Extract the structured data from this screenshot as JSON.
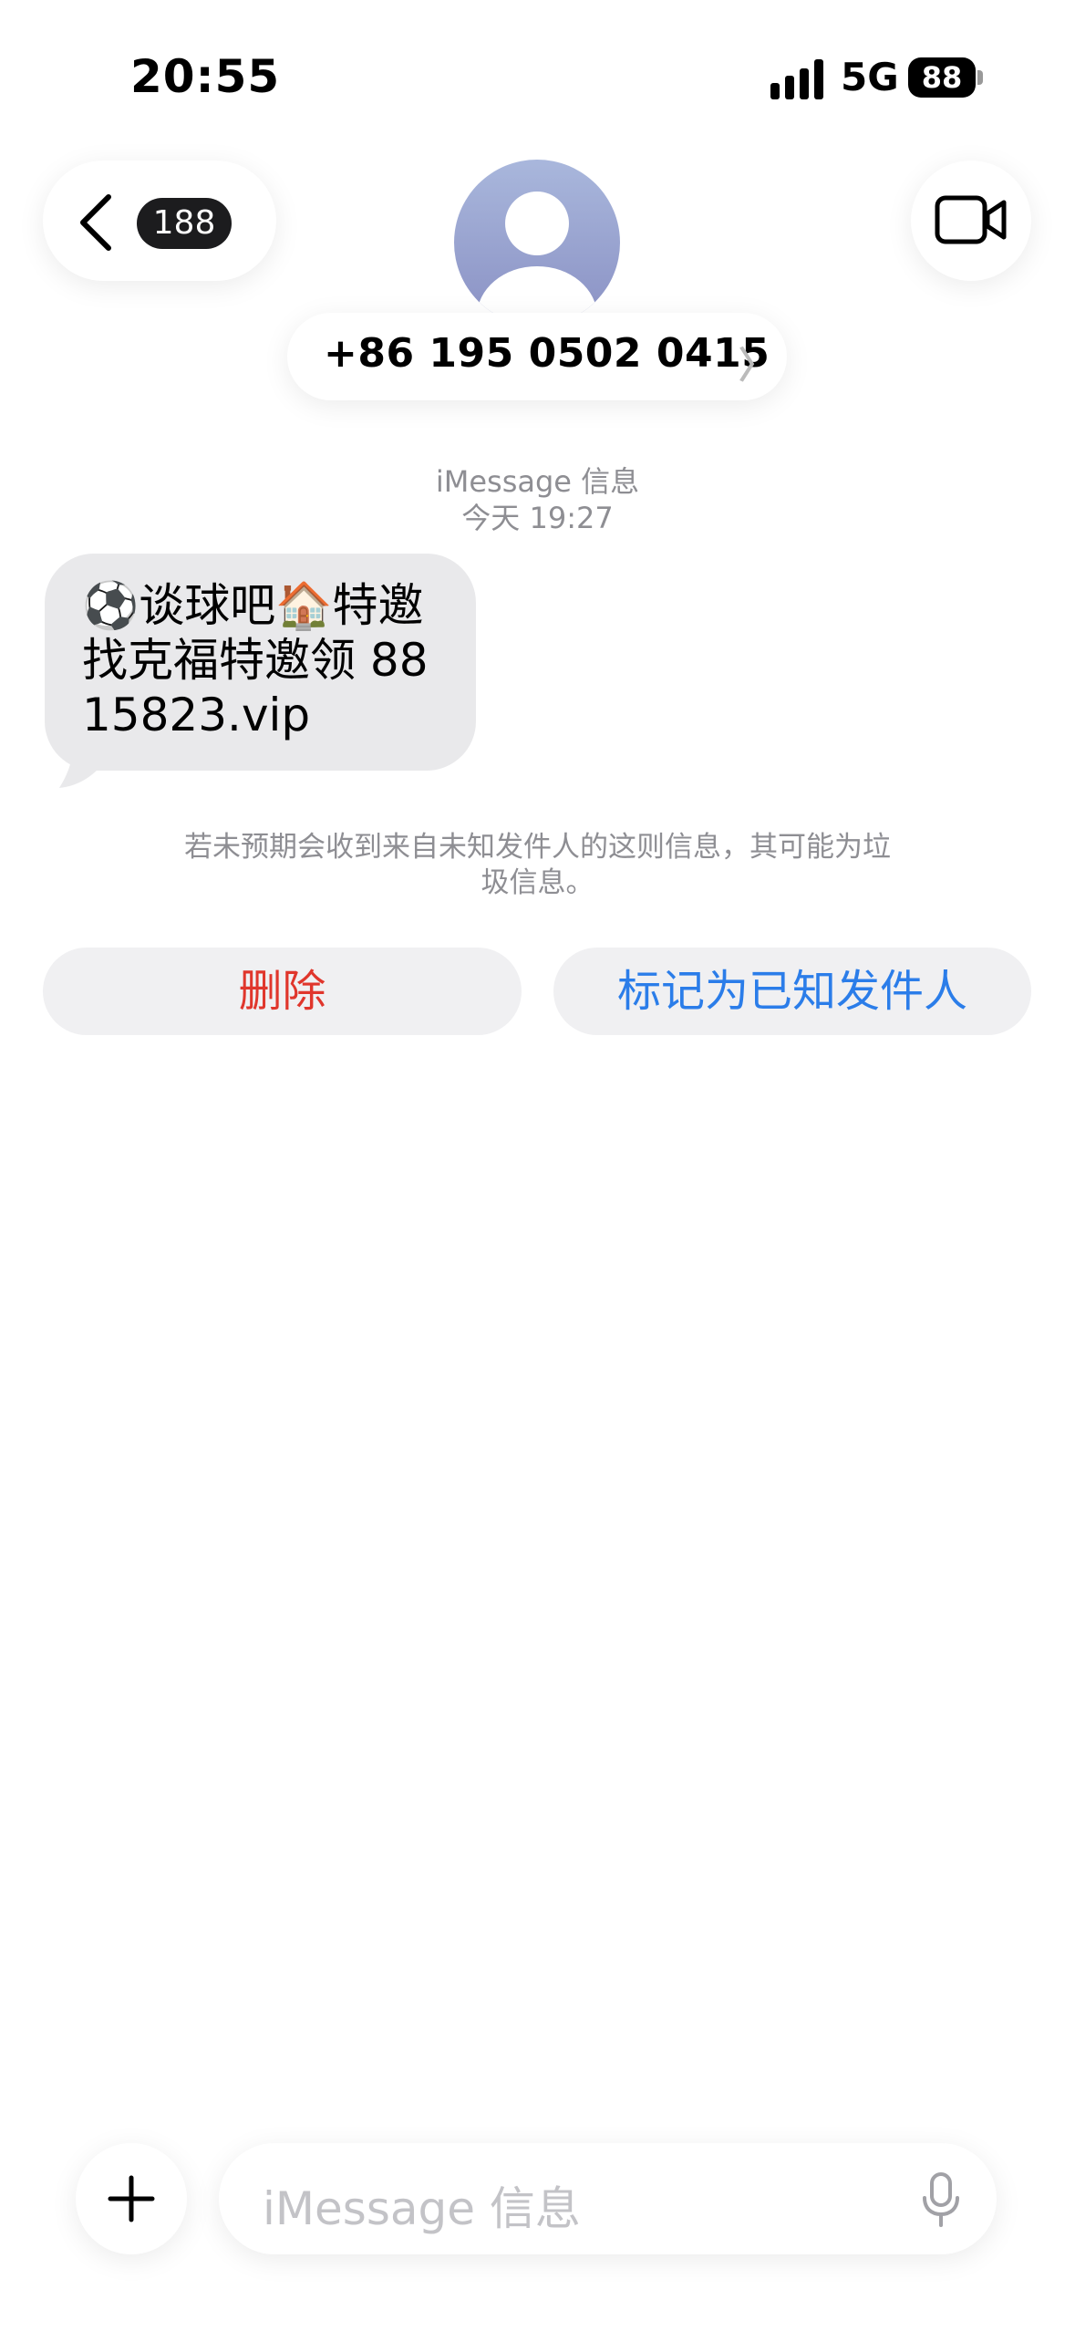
{
  "status_bar": {
    "time": "20:55",
    "network": "5G",
    "battery": "88"
  },
  "header": {
    "unread_count": "188",
    "contact_number": "+86 195 0502 0415",
    "chevron": "〉"
  },
  "meta": {
    "service": "iMessage 信息",
    "timestamp": "今天 19:27"
  },
  "message": {
    "text": "⚽谈球吧🏠特邀找克福特邀领 88 15823.vip"
  },
  "spam_notice": "若未预期会收到来自未知发件人的这则信息，其可能为垃圾信息。",
  "actions": {
    "delete": "删除",
    "mark_known": "标记为已知发件人"
  },
  "composer": {
    "placeholder": "iMessage 信息"
  },
  "colors": {
    "delete": "#e0362c",
    "mark_known": "#2b7de9",
    "bubble": "#e9e9eb"
  },
  "icons": [
    "signal-icon",
    "battery-icon",
    "back-chevron-icon",
    "video-camera-icon",
    "avatar-person-icon",
    "plus-icon",
    "microphone-icon"
  ]
}
